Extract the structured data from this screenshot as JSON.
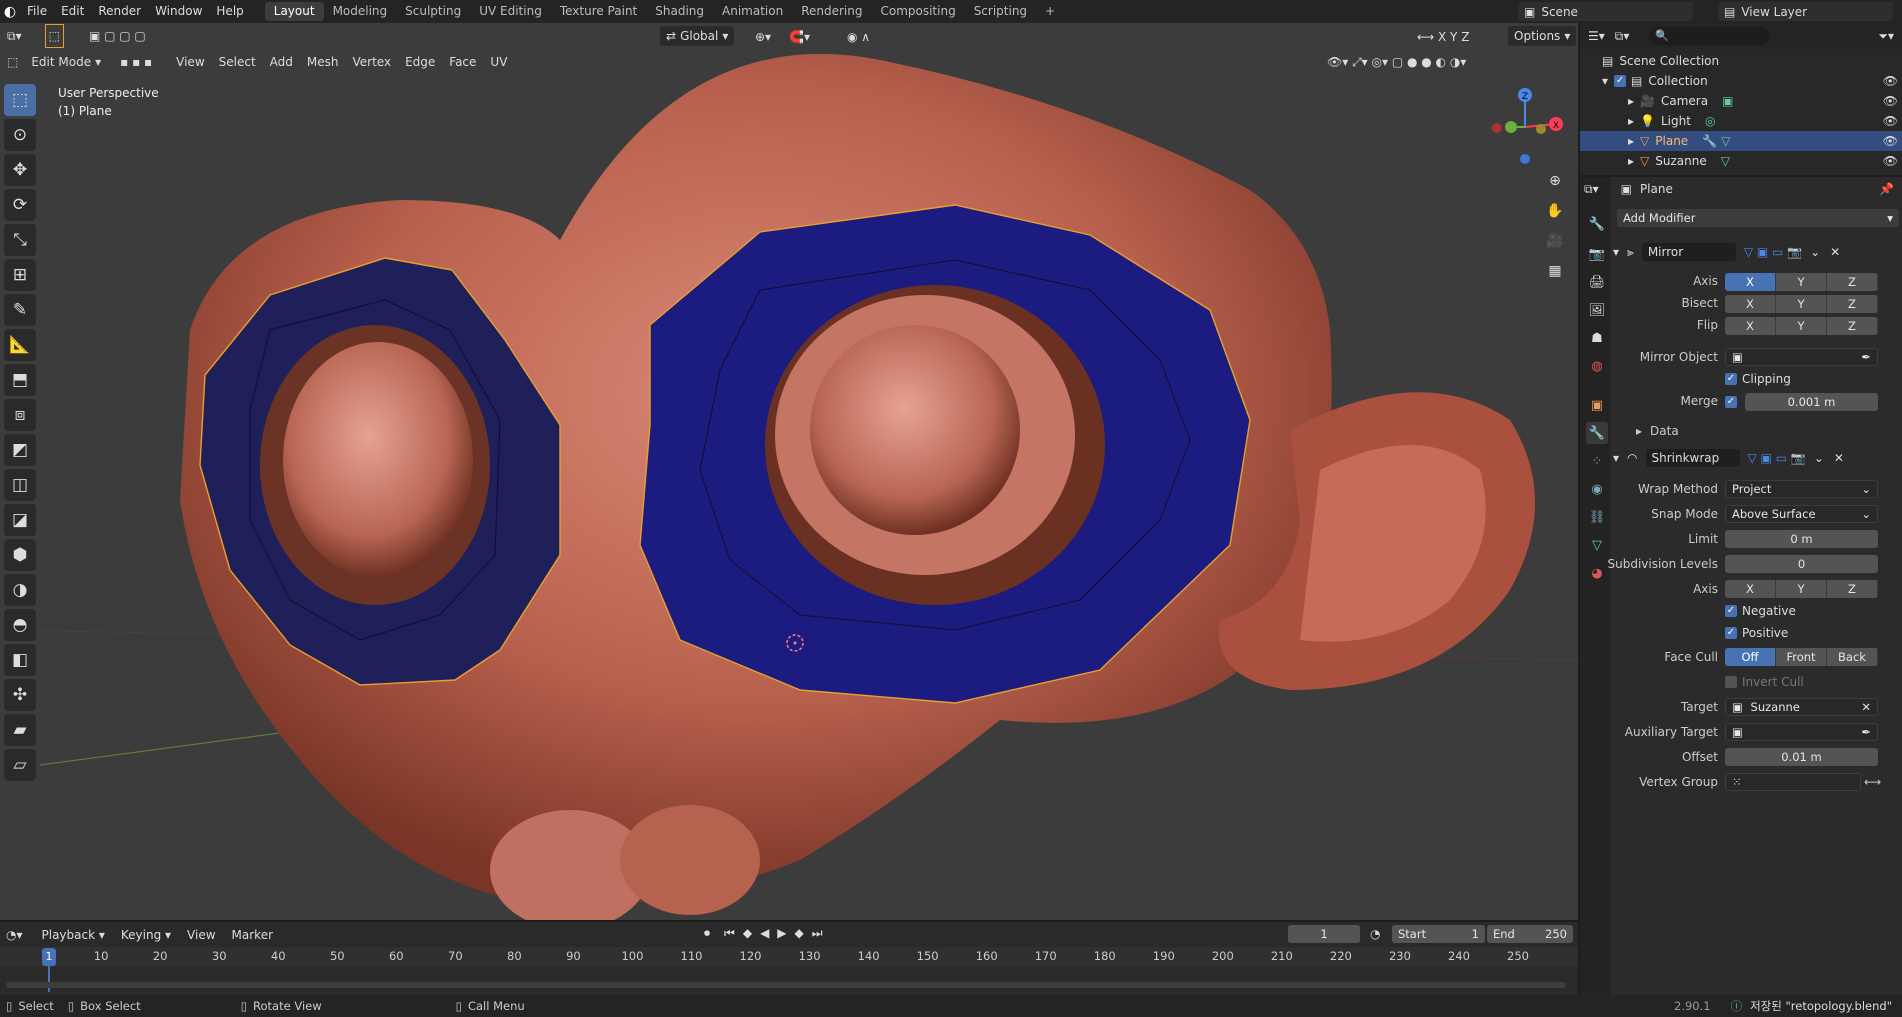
{
  "topbar": {
    "menus": [
      "File",
      "Edit",
      "Render",
      "Window",
      "Help"
    ],
    "workspaces": [
      "Layout",
      "Modeling",
      "Sculpting",
      "UV Editing",
      "Texture Paint",
      "Shading",
      "Animation",
      "Rendering",
      "Compositing",
      "Scripting"
    ],
    "active_workspace": "Layout",
    "scene": "Scene",
    "view_layer": "View Layer"
  },
  "viewport": {
    "mode": "Edit Mode",
    "menus": [
      "View",
      "Select",
      "Add",
      "Mesh",
      "Vertex",
      "Edge",
      "Face",
      "UV"
    ],
    "orientation": "Global",
    "options": "Options",
    "info_line1": "User Perspective",
    "info_line2": "(1) Plane",
    "gizmo_axes": [
      "X",
      "Y",
      "Z"
    ]
  },
  "outliner": {
    "root": "Scene Collection",
    "collection": "Collection",
    "items": [
      {
        "name": "Camera",
        "selected": false
      },
      {
        "name": "Light",
        "selected": false
      },
      {
        "name": "Plane",
        "selected": true
      },
      {
        "name": "Suzanne",
        "selected": false
      }
    ]
  },
  "properties": {
    "object_name": "Plane",
    "add_modifier": "Add Modifier",
    "mirror": {
      "name": "Mirror",
      "axis_label": "Axis",
      "bisect_label": "Bisect",
      "flip_label": "Flip",
      "xyz": [
        "X",
        "Y",
        "Z"
      ],
      "axis_on": [
        true,
        false,
        false
      ],
      "mirror_object_label": "Mirror Object",
      "clipping_label": "Clipping",
      "merge_label": "Merge",
      "merge_value": "0.001 m",
      "data_label": "Data"
    },
    "shrinkwrap": {
      "name": "Shrinkwrap",
      "wrap_method_label": "Wrap Method",
      "wrap_method": "Project",
      "snap_mode_label": "Snap Mode",
      "snap_mode": "Above Surface",
      "limit_label": "Limit",
      "limit": "0 m",
      "subdiv_label": "Subdivision Levels",
      "subdiv": "0",
      "axis_label": "Axis",
      "negative_label": "Negative",
      "positive_label": "Positive",
      "face_cull_label": "Face Cull",
      "face_cull": [
        "Off",
        "Front",
        "Back"
      ],
      "invert_cull_label": "Invert Cull",
      "target_label": "Target",
      "target": "Suzanne",
      "aux_target_label": "Auxiliary Target",
      "offset_label": "Offset",
      "offset": "0.01 m",
      "vgroup_label": "Vertex Group"
    }
  },
  "timeline": {
    "menus": [
      "Playback",
      "Keying",
      "View",
      "Marker"
    ],
    "current_frame": "1",
    "start_label": "Start",
    "start": "1",
    "end_label": "End",
    "end": "250",
    "ticks": [
      "1",
      "10",
      "20",
      "30",
      "40",
      "50",
      "60",
      "70",
      "80",
      "90",
      "100",
      "110",
      "120",
      "130",
      "140",
      "150",
      "160",
      "170",
      "180",
      "190",
      "200",
      "210",
      "220",
      "230",
      "240",
      "250"
    ]
  },
  "statusbar": {
    "select": "Select",
    "box_select": "Box Select",
    "rotate_view": "Rotate View",
    "call_menu": "Call Menu",
    "version": "2.90.1",
    "saved_msg": "저장된 \"retopology.blend\""
  },
  "colors": {
    "accent": "#4772b3",
    "selected_row": "#334d80",
    "mesh_face": "#1d1d7a",
    "skin": "#b8604d"
  }
}
